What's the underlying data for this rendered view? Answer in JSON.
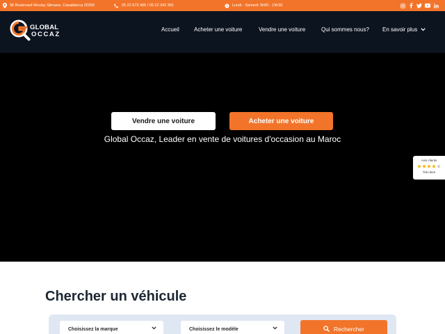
{
  "topbar": {
    "address": "96 Boulevard Moulay Slimane, Casablanca 20250",
    "phones": "05 22 673 405 / 05 22 342 391",
    "hours": "Lundi - Samedi: 9h00 - 19h30",
    "social": [
      "instagram-icon",
      "facebook-icon",
      "twitter-icon",
      "youtube-icon",
      "linkedin-icon"
    ]
  },
  "header": {
    "logo_line1": "GLOBAL",
    "logo_line2": "OCCAZ",
    "nav": [
      {
        "label": "Accueil"
      },
      {
        "label": "Acheter une voiture"
      },
      {
        "label": "Vendre une voiture"
      },
      {
        "label": "Qui sommes nous?"
      },
      {
        "label": "En savoir plus"
      }
    ]
  },
  "hero": {
    "sell_button": "Vendre une voiture",
    "buy_button": "Acheter une voiture",
    "tagline": "Global Occaz, Leader en vente de voitures d'occasion au Maroc"
  },
  "reviews": {
    "label": "Avis clients",
    "rating": 4,
    "max": 5,
    "quality": "Très bien"
  },
  "search": {
    "title": "Chercher un véhicule",
    "brand_placeholder": "Choisissez la marque",
    "model_placeholder": "Choisissez le modèle",
    "button": "Rechercher"
  },
  "colors": {
    "accent": "#f2742a",
    "header_bg": "#0c1420",
    "hero_bg": "#000000",
    "panel_bg": "#dfe7f3"
  }
}
